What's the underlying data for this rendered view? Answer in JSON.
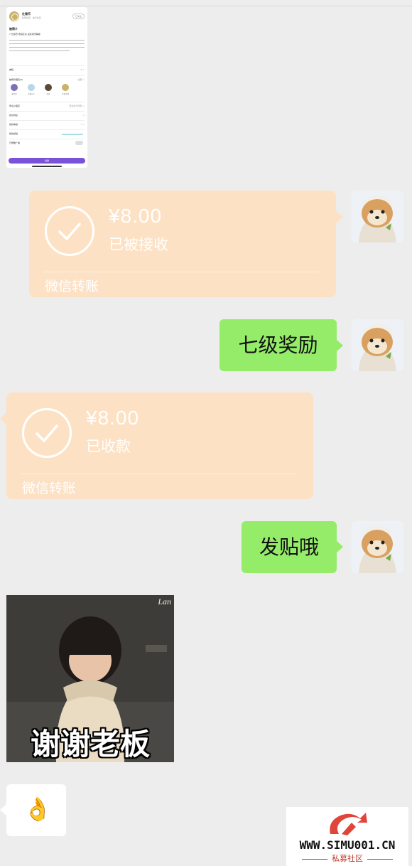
{
  "shared_screenshot": {
    "app_name": "仕锦币",
    "app_sub": "私募社区 · 发行社区",
    "tag": "已关注",
    "intro_heading": "被简介",
    "intro_sub": "7 仕锦币 质感互关 最好用币等级",
    "rows": [
      {
        "label": "被短",
        "value": "5 >"
      },
      {
        "label": "被所管理员(4)",
        "value": "全部 >"
      },
      {
        "label": "申请小程序",
        "value": "查出学习所有 >"
      },
      {
        "label": "投诉诉任",
        "value": ">"
      },
      {
        "label": "我的等级",
        "value": "7 >"
      },
      {
        "label": "我的经验",
        "value": ""
      },
      {
        "label": "已佩戴广播",
        "value": ""
      }
    ],
    "admins": [
      "墨灯风",
      "女雅seo",
      "奕真",
      "仕锦币精"
    ],
    "button_label": "进群"
  },
  "messages": [
    {
      "type": "transfer",
      "side": "right",
      "amount": "¥8.00",
      "status": "已被接收",
      "brand": "微信转账"
    },
    {
      "type": "text",
      "side": "right",
      "text": "七级奖励"
    },
    {
      "type": "transfer",
      "side": "left",
      "amount": "¥8.00",
      "status": "已收款",
      "brand": "微信转账"
    },
    {
      "type": "text",
      "side": "right",
      "text": "发贴哦"
    },
    {
      "type": "sticker",
      "side": "left",
      "caption": "谢谢老板",
      "mark": "Lan"
    },
    {
      "type": "emoji",
      "side": "left",
      "text": "👌"
    }
  ],
  "watermark": {
    "site": "WWW.SIMU001.CN",
    "cn": "私募社区"
  },
  "colors": {
    "background": "#ededed",
    "transfer_bubble": "#fde1c4",
    "green_bubble": "#95ec69",
    "accent_button": "#7a52d8"
  }
}
